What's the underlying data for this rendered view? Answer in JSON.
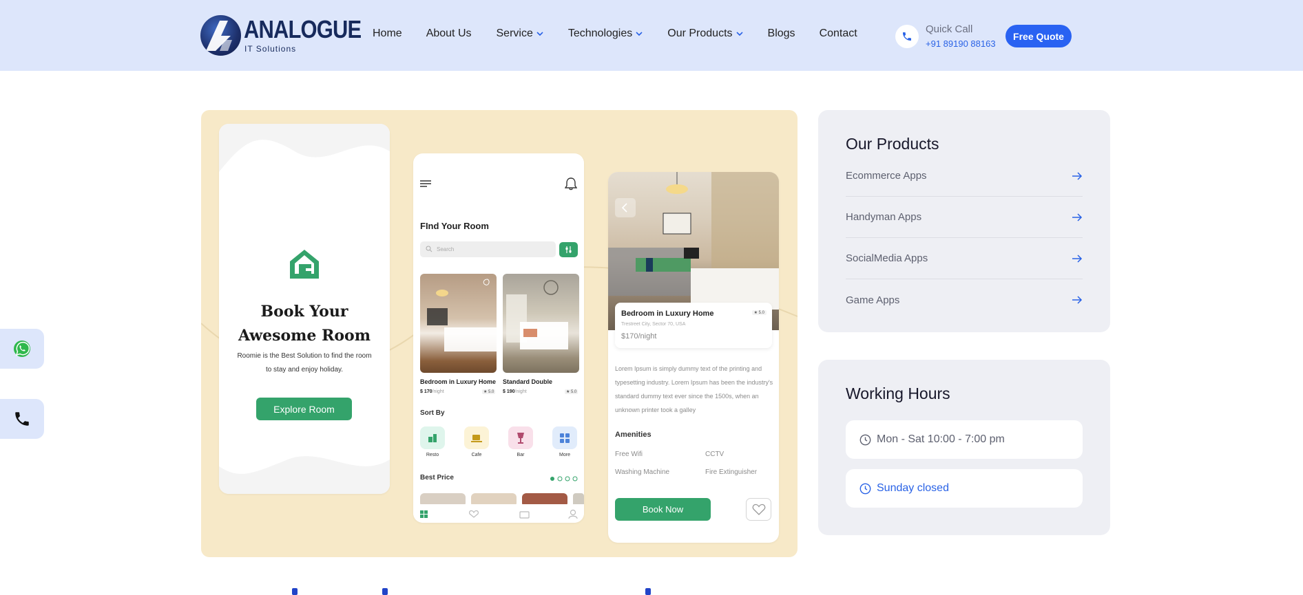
{
  "header": {
    "logo_word": "ANALOGUE",
    "logo_sub": "IT Solutions",
    "nav": [
      {
        "label": "Home",
        "dropdown": false
      },
      {
        "label": "About Us",
        "dropdown": false
      },
      {
        "label": "Service",
        "dropdown": true
      },
      {
        "label": "Technologies",
        "dropdown": true
      },
      {
        "label": "Our Products",
        "dropdown": true
      },
      {
        "label": "Blogs",
        "dropdown": false
      },
      {
        "label": "Contact",
        "dropdown": false
      }
    ],
    "quick_call_label": "Quick Call",
    "quick_call_number": "+91 89190 88163",
    "quote_label": "Free Quote",
    "accent": "#2962f2",
    "bg": "#dde6fb"
  },
  "hero": {
    "bg": "#f7e9c8",
    "phone1": {
      "title_line1": "Book Your",
      "title_line2": "Awesome Room",
      "desc_line1": "Roomie is the Best Solution to find the room",
      "desc_line2": "to stay and enjoy holiday.",
      "button": "Explore Room"
    },
    "phone2": {
      "title": "FInd Your Room",
      "search_placeholder": "Search",
      "rooms": [
        {
          "name": "Bedroom in Luxury Home",
          "price": "$ 170",
          "per": "/night",
          "rating": "★ 5.0"
        },
        {
          "name": "Standard Double",
          "price": "$ 190",
          "per": "/night",
          "rating": "★ 5.0"
        }
      ],
      "sort_title": "Sort By",
      "sort": [
        {
          "label": "Resto",
          "color": "#dff5ec"
        },
        {
          "label": "Cafe",
          "color": "#fcf3d6"
        },
        {
          "label": "Bar",
          "color": "#f9e0ea"
        },
        {
          "label": "More",
          "color": "#e1ecfb"
        }
      ],
      "best_price_title": "Best Price"
    },
    "phone3": {
      "card_title": "Bedroom in Luxury Home",
      "card_location": "Trestreet City, Sector 70, USA",
      "card_price": "$170/night",
      "card_rating": "★ 5.0",
      "desc": "Lorem Ipsum is simply dummy text of the printing and typesetting industry. Lorem Ipsum has been the industry's standard dummy text ever since the 1500s, when an unknown printer took a galley",
      "amenities_title": "Amenities",
      "amenities": [
        "Free Wifi",
        "CCTV",
        "Washing Machine",
        "Fire Extinguisher"
      ],
      "book_button": "Book Now"
    },
    "green": "#34a36b"
  },
  "products": {
    "title": "Our Products",
    "items": [
      "Ecommerce Apps",
      "Handyman Apps",
      "SocialMedia Apps",
      "Game Apps"
    ]
  },
  "hours": {
    "title": "Working Hours",
    "rows": [
      "Mon - Sat 10:00 - 7:00 pm",
      "Sunday closed"
    ]
  },
  "floating": {
    "icons": [
      "whatsapp-icon",
      "phone-icon"
    ]
  }
}
